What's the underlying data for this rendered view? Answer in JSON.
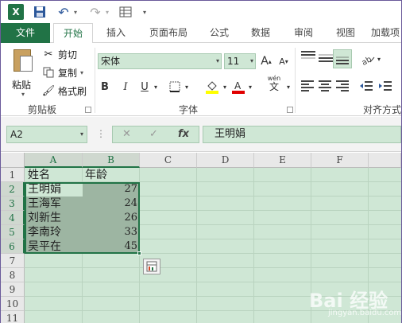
{
  "qat": {
    "app_logo": "X",
    "undo_dd": "▾",
    "redo_dd": "▾",
    "custom_dd": "▾"
  },
  "tabs": [
    "文件",
    "开始",
    "插入",
    "页面布局",
    "公式",
    "数据",
    "审阅",
    "视图",
    "加载项"
  ],
  "clipboard": {
    "paste_label": "粘贴",
    "cut_label": "剪切",
    "copy_label": "复制",
    "format_painter_label": "格式刷",
    "group_label": "剪贴板"
  },
  "font": {
    "name": "宋体",
    "size": "11",
    "grow": "A",
    "shrink": "A",
    "bold": "B",
    "italic": "I",
    "underline": "U",
    "wen": "wén",
    "wen_char": "文",
    "group_label": "字体"
  },
  "alignment": {
    "group_label": "对齐方式"
  },
  "formula_bar": {
    "name_box": "A2",
    "cancel": "✕",
    "enter": "✓",
    "fx": "fx",
    "value": "王明娟"
  },
  "columns": [
    "A",
    "B",
    "C",
    "D",
    "E",
    "F"
  ],
  "rows": [
    "1",
    "2",
    "3",
    "4",
    "5",
    "6",
    "7",
    "8",
    "9",
    "10",
    "11"
  ],
  "cells": {
    "header_a": "姓名",
    "header_b": "年龄",
    "data": [
      {
        "name": "王明娟",
        "age": "27"
      },
      {
        "name": "王海军",
        "age": "24"
      },
      {
        "name": "刘新生",
        "age": "26"
      },
      {
        "name": "李南玲",
        "age": "33"
      },
      {
        "name": "吴平在",
        "age": "45"
      }
    ]
  },
  "watermark": {
    "main": "Bai 经验",
    "sub": "jingyan.baidu.com"
  },
  "colors": {
    "accent": "#217346",
    "cell_bg": "#cfe7d5",
    "selection": "#9db5a2"
  }
}
